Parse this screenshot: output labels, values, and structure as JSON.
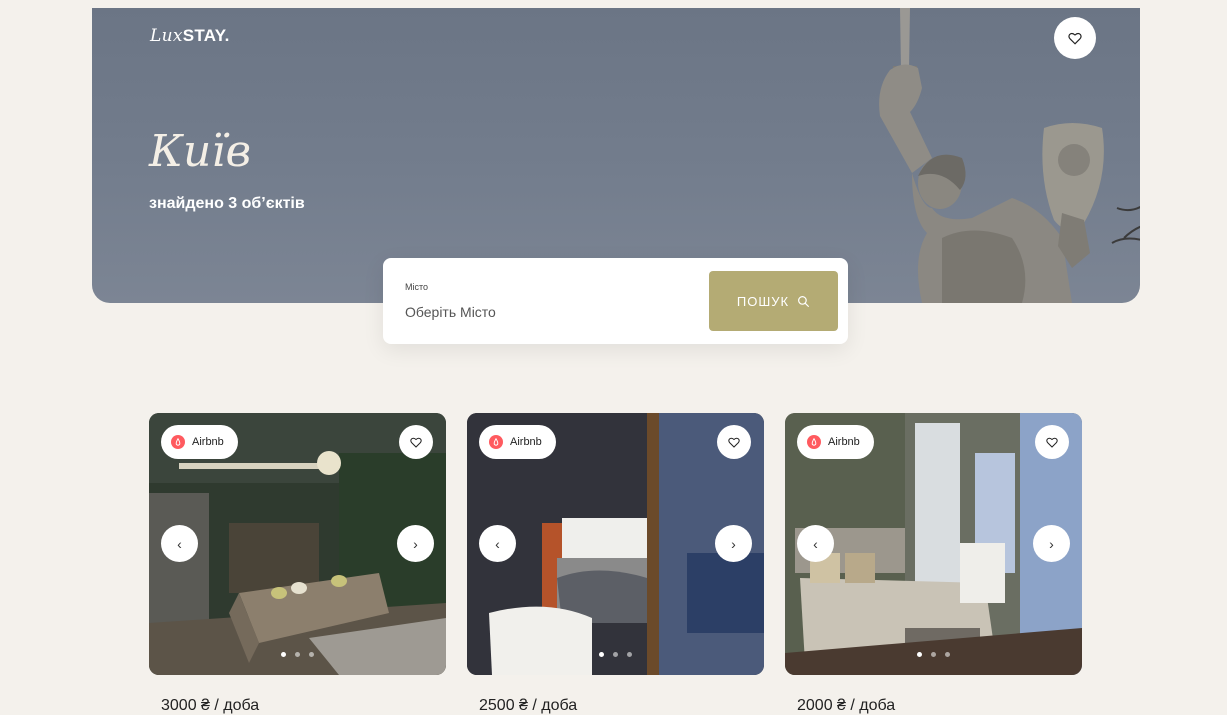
{
  "brand": {
    "lux": "Lux",
    "stay": "STAY."
  },
  "hero": {
    "city": "Київ",
    "found_text": "знайдено 3 об’єктів"
  },
  "search": {
    "label": "Місто",
    "placeholder": "Оберіть Місто",
    "button_label": "ПОШУК"
  },
  "colors": {
    "accent": "#b4ab74",
    "background": "#f4f1ec",
    "hero": "#737d8d",
    "airbnb": "#ff5a5f"
  },
  "listings": [
    {
      "source": "Airbnb",
      "price": "3000 ₴ / доба",
      "slides": 3,
      "active_slide": 1
    },
    {
      "source": "Airbnb",
      "price": "2500 ₴ / доба",
      "slides": 3,
      "active_slide": 1
    },
    {
      "source": "Airbnb",
      "price": "2000 ₴ / доба",
      "slides": 3,
      "active_slide": 1
    }
  ]
}
